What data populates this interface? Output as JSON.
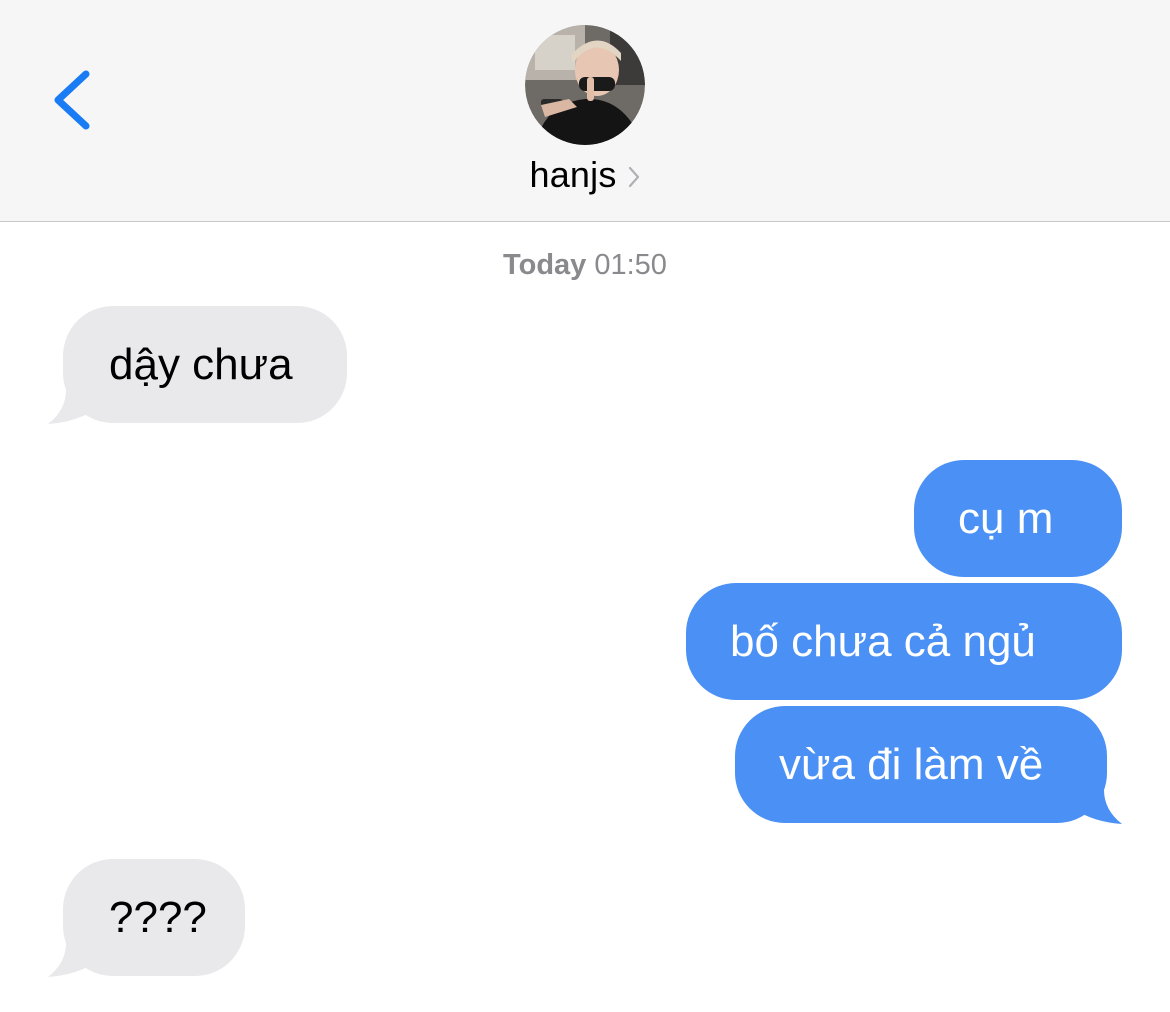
{
  "header": {
    "contact_name": "hanjs",
    "back_icon": "chevron-left-icon",
    "name_chevron_icon": "chevron-right-icon",
    "accent_color": "#1a7cf5"
  },
  "timestamp": {
    "day": "Today",
    "time": "01:50"
  },
  "messages": [
    {
      "direction": "incoming",
      "text": "dậy chưa"
    },
    {
      "direction": "outgoing",
      "text": "cụ m"
    },
    {
      "direction": "outgoing",
      "text": "bố chưa cả ngủ"
    },
    {
      "direction": "outgoing",
      "text": "vừa đi làm về"
    },
    {
      "direction": "incoming",
      "text": "????"
    }
  ],
  "colors": {
    "incoming_bubble": "#e9e9eb",
    "outgoing_bubble": "#4a90f5",
    "header_background": "#f6f6f6"
  }
}
